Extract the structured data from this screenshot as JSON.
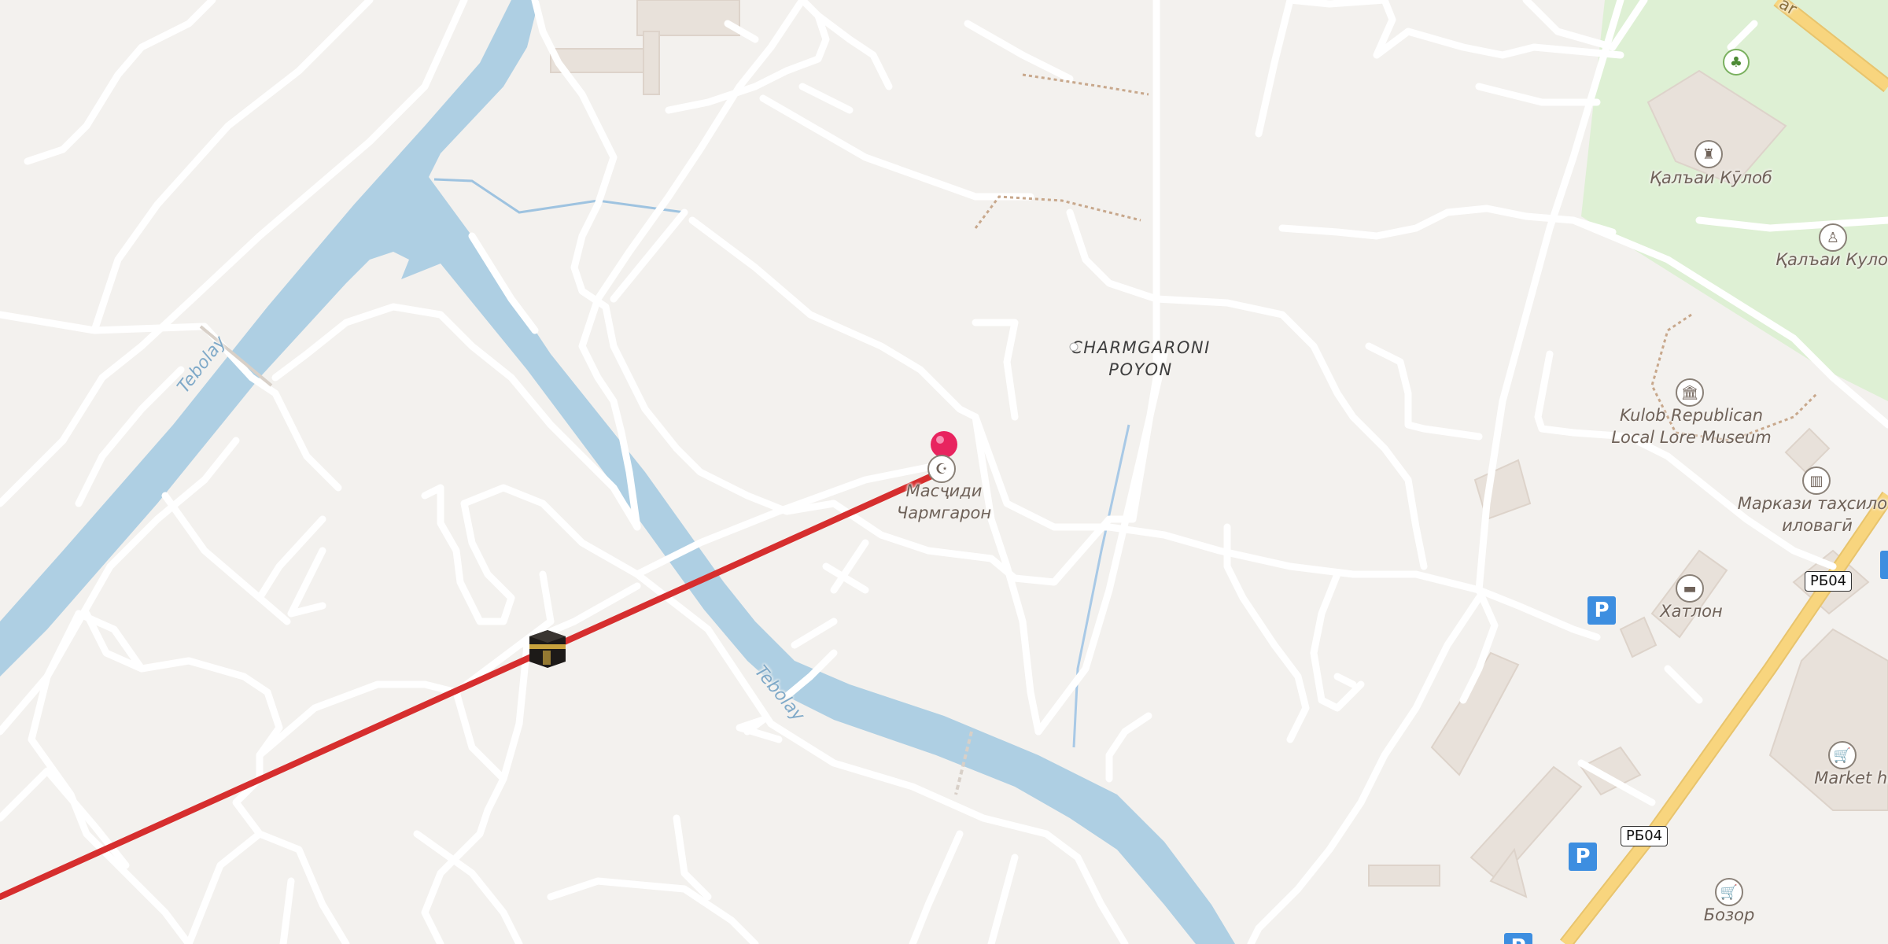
{
  "map": {
    "route_color": "#d62e2e",
    "water_color": "#aecfe3",
    "park_color": "#def0d4",
    "road_color": "#ffffff",
    "highway_color": "#f8d57e",
    "pin_color": "#e8245f"
  },
  "labels": {
    "river_upper": "Tebolay",
    "river_lower": "Tebolay",
    "place_line1": "CHARMGARONI",
    "place_line2": "POYON",
    "mosque_line1": "Масҷиди",
    "mosque_line2": "Чармгарон",
    "fort1": "Қалъаи Кӯлоб",
    "fort2": "Қалъаи Кулоб",
    "museum_line1": "Kulob Republican",
    "museum_line2": "Local Lore Museum",
    "center_line1": "Маркази таҳсилот",
    "center_line2": "иловагӣ",
    "hotel": "Хатлон",
    "market": "Market hall",
    "bazaar": "Бозор",
    "street_top": "ar",
    "route_shield_1": "РБ04",
    "route_shield_2": "РБ04",
    "parking": "P"
  },
  "icons": {
    "pin": "location-pin-icon",
    "kaaba": "kaaba-icon",
    "mosque": "mosque-icon",
    "castle": "castle-icon",
    "monument": "monument-icon",
    "museum": "museum-icon",
    "library": "library-icon",
    "hotel": "bed-icon",
    "shop": "shopping-cart-icon",
    "tree": "tree-icon",
    "parking": "parking-icon"
  }
}
